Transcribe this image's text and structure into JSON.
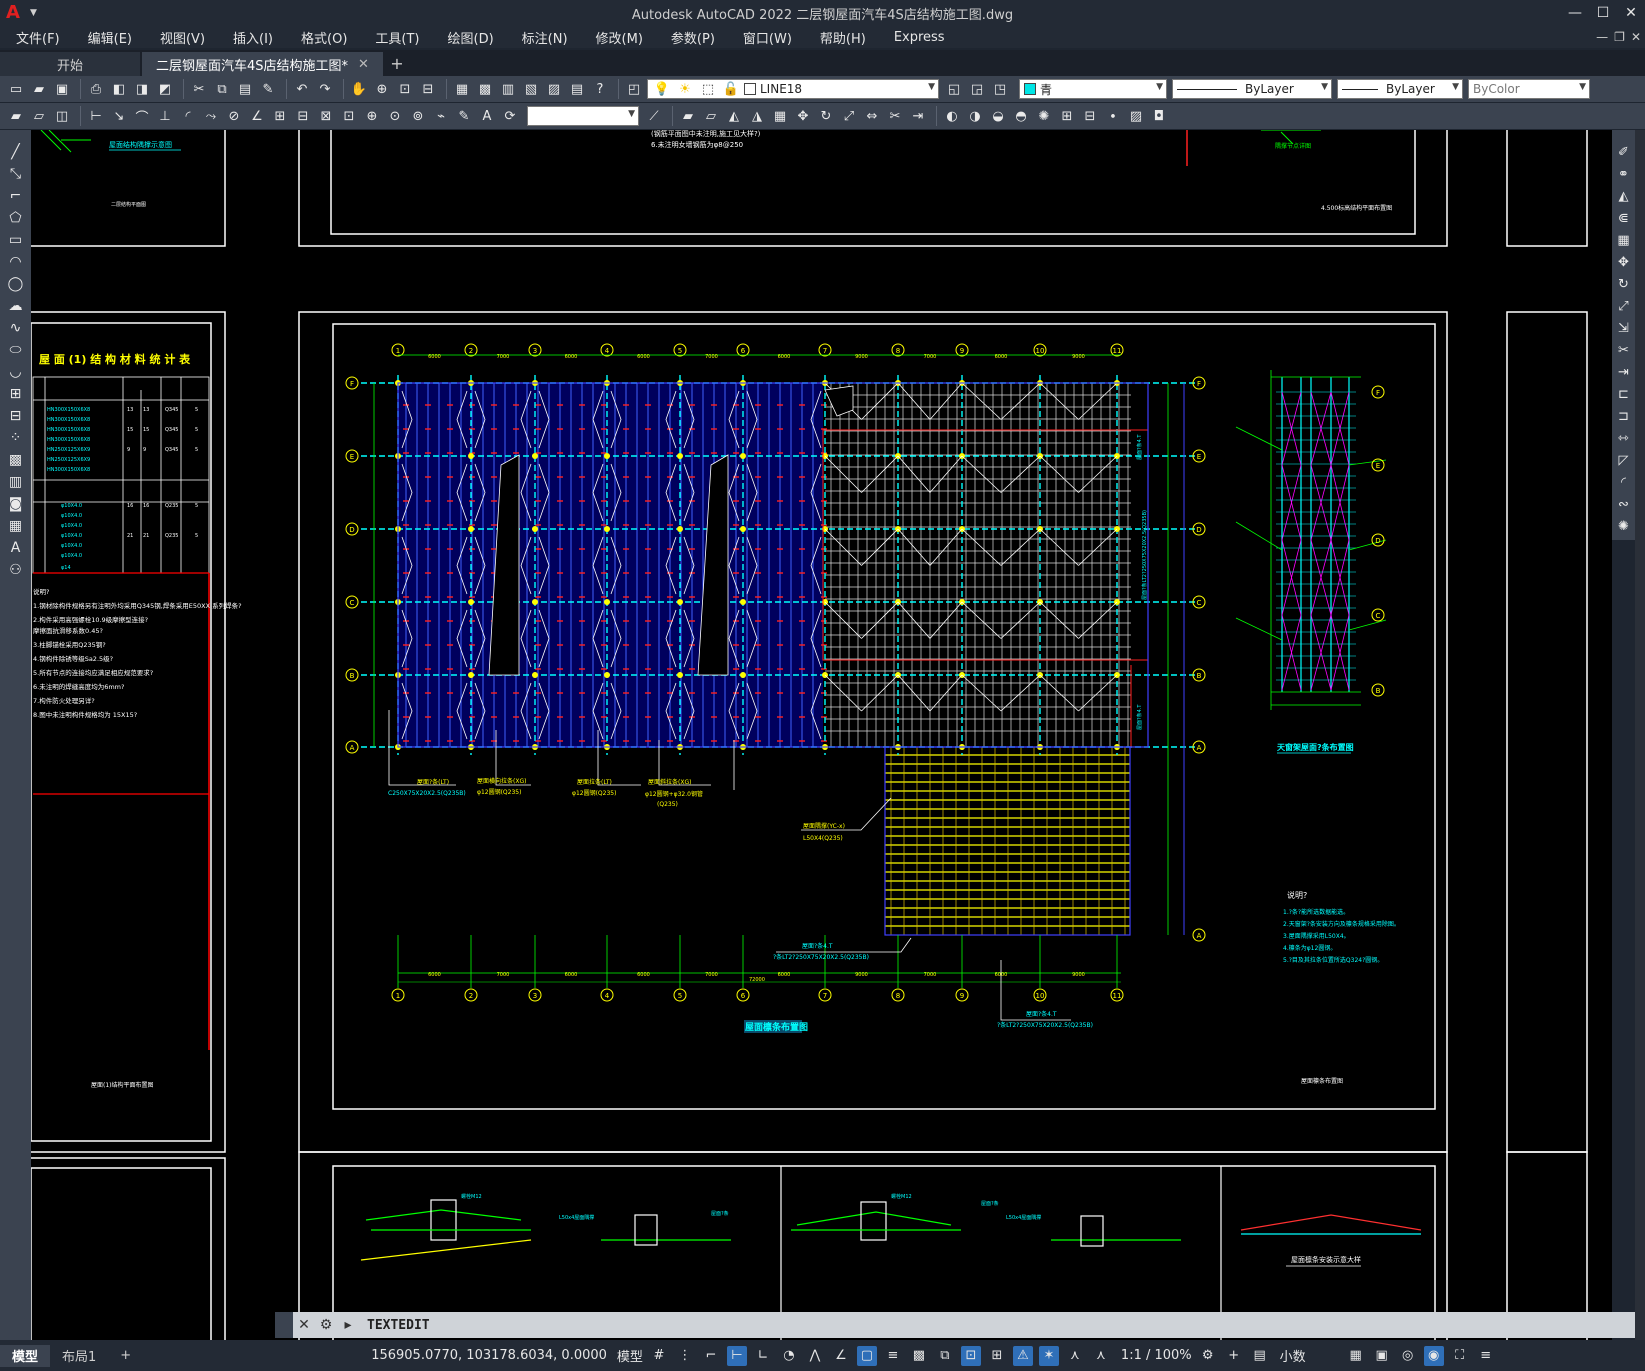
{
  "app": {
    "title": "Autodesk AutoCAD 2022    二层钢屋面汽车4S店结构施工图.dwg",
    "logo": "A"
  },
  "menu": [
    "文件(F)",
    "编辑(E)",
    "视图(V)",
    "插入(I)",
    "格式(O)",
    "工具(T)",
    "绘图(D)",
    "标注(N)",
    "修改(M)",
    "参数(P)",
    "窗口(W)",
    "帮助(H)",
    "Express"
  ],
  "tabs": {
    "start": "开始",
    "drawing": "二层钢屋面汽车4S店结构施工图*"
  },
  "layer": {
    "name": "LINE18"
  },
  "properties": {
    "color": "青",
    "color_hex": "#00e5e5",
    "linetype": "ByLayer",
    "lineweight": "ByLayer",
    "plotstyle": "ByColor"
  },
  "drawing": {
    "main_title": "屋面檩条布置图",
    "skylight_title": "天窗架屋面?条布置图",
    "notes_title": "说明?",
    "notes": [
      "1.?条?能所选数据能选。",
      "2.天窗架?条安装方向及檩条规格采用除图。",
      "3.屋面隅撑采用L50X4。",
      "4.檩条为φ12圆钢。",
      "5.?目及其拉条位置所选Q324?圆钢。"
    ],
    "left_table_title": "屋 面 (1) 结 构 材 料 统 计 表",
    "left_sheet_label": "屋面(1)结构平面布置图",
    "right_sheet_label": "屋面檩条布置图",
    "top_sheet_label": "4.500标高结构平面布置图",
    "top_note": "6.未注明女墙钢筋为φ8@250",
    "top_note2": "(钢筋平面图中未注明,施工见大样?)",
    "top_left_label": "二层结构平面图",
    "top_left_title": "屋面结构隅撑示意图",
    "top_right_label": "隅撑节点详图",
    "left_notes": [
      "说明?",
      "1.钢材除构件规格另有注明外均采用Q345钢,焊条采用E50XX  系列焊条?",
      "2.构件采用高强螺栓10.9级摩擦型连接?",
      "  摩擦面抗滑移系数0.45?",
      "3.柱脚锚栓采用Q235钢?",
      "4.钢构件除锈等级Sa2.5级?",
      "5.所有节点的连接均应满足相应规范要求?",
      "6.未注明的焊缝高度均为6mm?",
      "7.构件防火处理另详?",
      "8.图中未注明构件规格均为 15X15?"
    ],
    "labels": {
      "purlin1": "屋面?条(LT)",
      "purlin1_spec": "C250X75X20X2.5(Q235B)",
      "tie1": "屋面横向拉条(XG)",
      "tie1_spec": "φ12圆钢(Q235)",
      "tie2": "屋面拉条(LT)",
      "tie2_spec": "φ12圆钢(Q235)",
      "tie3": "屋面斜拉条(XG)",
      "tie3_spec": "φ12圆钢+φ32.0钢管",
      "tie3_spec2": "(Q235)",
      "brace": "屋面隅撑(YC-x)",
      "brace_spec": "L50X4(Q235)",
      "purlin2": "屋面?条4.T",
      "purlin2_spec": "?条LT2?250X75X20X2.5(Q235B)",
      "purlin3": "屋面?条4.T",
      "purlin3_spec": "?条LT2?250X75X20X2.5(Q235B)",
      "total_dim": "72000"
    },
    "col_axes": [
      "1",
      "2",
      "3",
      "4",
      "5",
      "6",
      "7",
      "8",
      "9",
      "10",
      "11"
    ],
    "row_axes": [
      "F",
      "E",
      "D",
      "C",
      "B",
      "A"
    ],
    "spans": [
      "6000",
      "7000",
      "6000",
      "6000",
      "7000",
      "6000",
      "9000",
      "7000",
      "6000",
      "9000"
    ],
    "bottom_title": "屋面檩条安装示意大样",
    "bottom_labels": [
      "L50x4屋面隅撑",
      "屋面?条",
      "屋面?条",
      "L50x4屋面隅撑",
      "螺栓M12",
      "螺栓M12"
    ]
  },
  "command": {
    "prompt": "TEXTEDIT"
  },
  "status": {
    "layouts": [
      "模型",
      "布局1"
    ],
    "coords": "156905.0770, 103178.6034, 0.0000",
    "space": "模型",
    "scale": "1:1 / 100%",
    "units": "小数"
  }
}
